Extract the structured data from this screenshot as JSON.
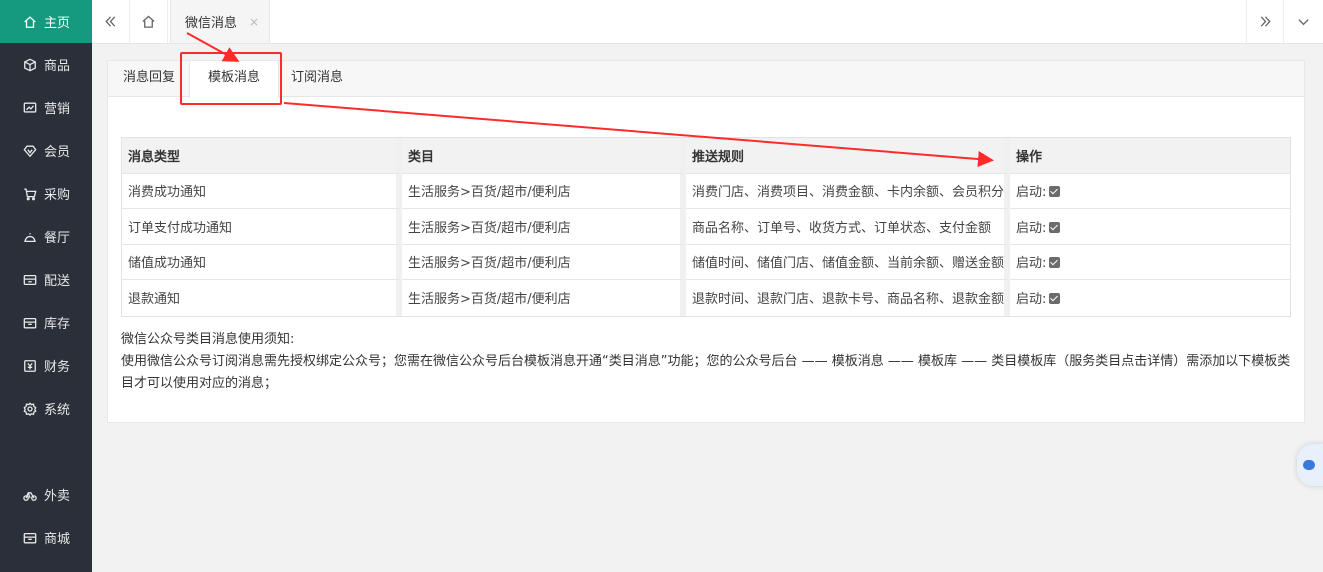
{
  "sidebar": {
    "items": [
      {
        "label": "主页",
        "icon": "home-icon"
      },
      {
        "label": "商品",
        "icon": "cube-icon"
      },
      {
        "label": "营销",
        "icon": "chart-icon"
      },
      {
        "label": "会员",
        "icon": "diamond-icon"
      },
      {
        "label": "采购",
        "icon": "cart-icon"
      },
      {
        "label": "餐厅",
        "icon": "cloche-icon"
      },
      {
        "label": "配送",
        "icon": "truck-icon"
      },
      {
        "label": "库存",
        "icon": "box-icon"
      },
      {
        "label": "财务",
        "icon": "wallet-icon"
      },
      {
        "label": "系统",
        "icon": "gear-icon"
      }
    ],
    "bottom_items": [
      {
        "label": "外卖",
        "icon": "bike-icon"
      },
      {
        "label": "商城",
        "icon": "store-icon"
      }
    ],
    "active_color": "#159a80"
  },
  "topbar": {
    "open_tab": "微信消息",
    "close_glyph": "×"
  },
  "subtabs": [
    {
      "label": "消息回复"
    },
    {
      "label": "模板消息"
    },
    {
      "label": "订阅消息"
    }
  ],
  "table": {
    "headers": [
      "消息类型",
      "类目",
      "推送规则",
      "操作"
    ],
    "rows": [
      {
        "type": "消费成功通知",
        "category": "生活服务>百货/超市/便利店",
        "rule": "消费门店、消费项目、消费金额、卡内余额、会员积分",
        "action": "启动:"
      },
      {
        "type": "订单支付成功通知",
        "category": "生活服务>百货/超市/便利店",
        "rule": "商品名称、订单号、收货方式、订单状态、支付金额",
        "action": "启动:"
      },
      {
        "type": "储值成功通知",
        "category": "生活服务>百货/超市/便利店",
        "rule": "储值时间、储值门店、储值金额、当前余额、赠送金额",
        "action": "启动:"
      },
      {
        "type": "退款通知",
        "category": "生活服务>百货/超市/便利店",
        "rule": "退款时间、退款门店、退款卡号、商品名称、退款金额",
        "action": "启动:"
      }
    ]
  },
  "notes": {
    "title": "微信公众号类目消息使用须知:",
    "body": "使用微信公众号订阅消息需先授权绑定公众号；您需在微信公众号后台模板消息开通“类目消息”功能；您的公众号后台 —— 模板消息 —— 模板库 —— 类目模板库（服务类目点击详情）需添加以下模板类目才可以使用对应的消息；"
  },
  "annotation_color": "#ff2a2a"
}
